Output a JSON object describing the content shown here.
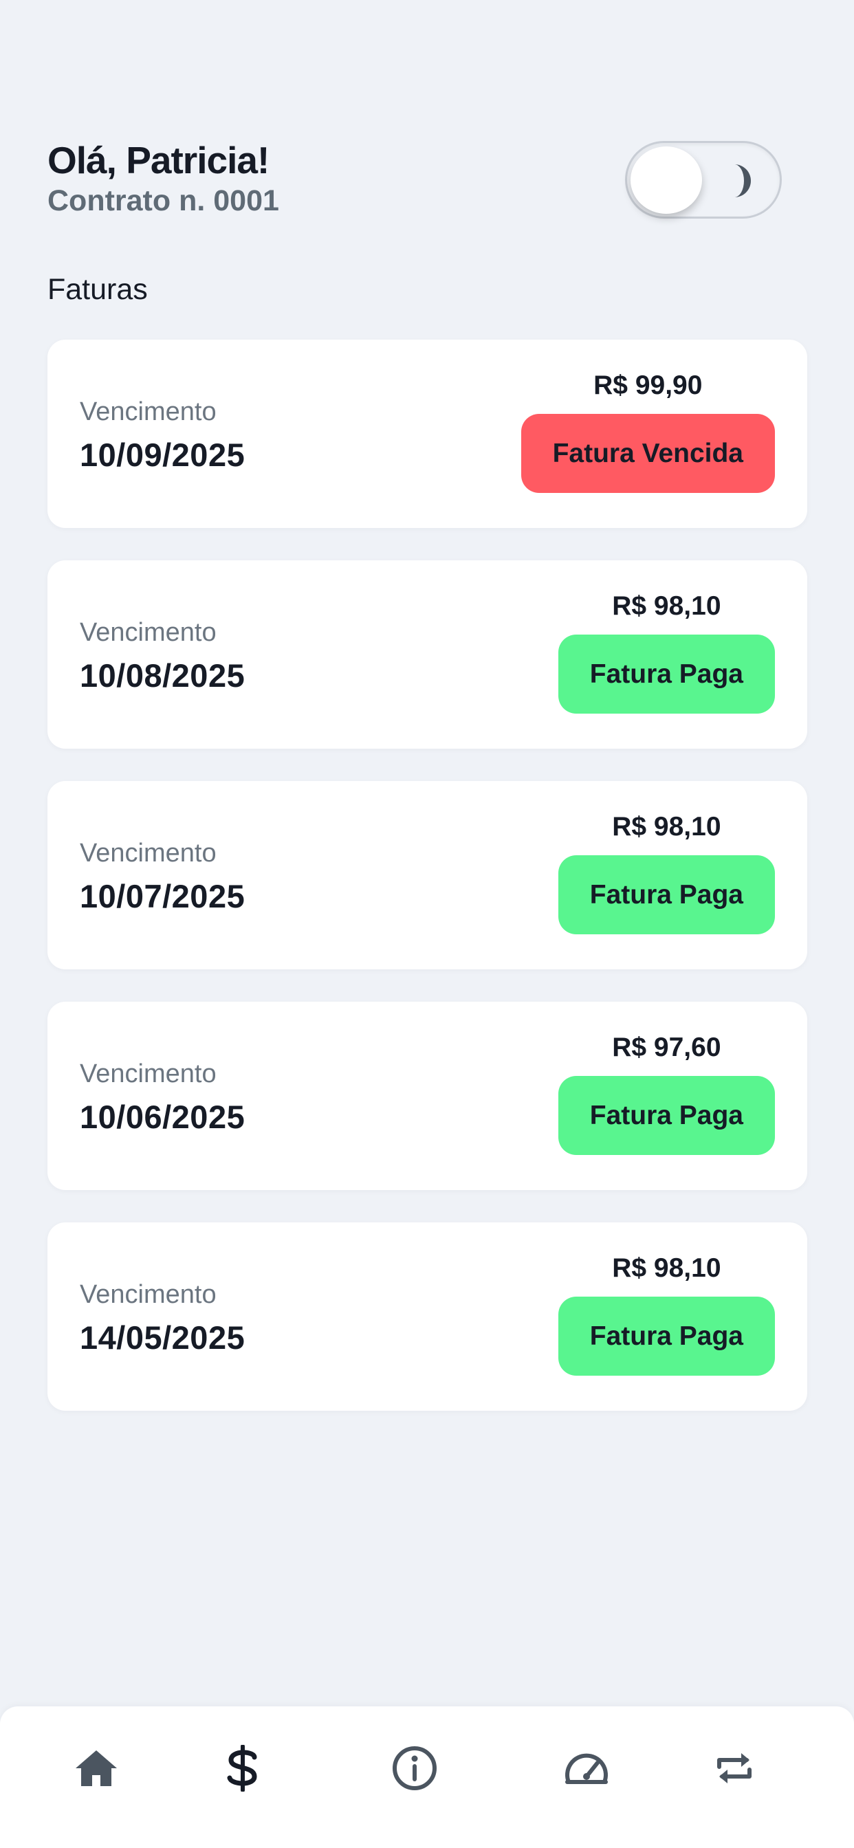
{
  "header": {
    "greeting": "Olá, Patricia!",
    "contract": "Contrato n. 0001"
  },
  "theme_toggle": {
    "icon": "moon-icon",
    "state": "off"
  },
  "section_title": "Faturas",
  "invoices": [
    {
      "due_label": "Vencimento",
      "due_date": "10/09/2025",
      "amount": "R$ 99,90",
      "status": "Fatura Vencida",
      "status_type": "overdue"
    },
    {
      "due_label": "Vencimento",
      "due_date": "10/08/2025",
      "amount": "R$ 98,10",
      "status": "Fatura Paga",
      "status_type": "paid"
    },
    {
      "due_label": "Vencimento",
      "due_date": "10/07/2025",
      "amount": "R$ 98,10",
      "status": "Fatura Paga",
      "status_type": "paid"
    },
    {
      "due_label": "Vencimento",
      "due_date": "10/06/2025",
      "amount": "R$ 97,60",
      "status": "Fatura Paga",
      "status_type": "paid"
    },
    {
      "due_label": "Vencimento",
      "due_date": "14/05/2025",
      "amount": "R$ 98,10",
      "status": "Fatura Paga",
      "status_type": "paid"
    }
  ],
  "nav": {
    "items": [
      "home-icon",
      "dollar-icon",
      "info-icon",
      "speedometer-icon",
      "repeat-icon"
    ],
    "active": "dollar-icon"
  },
  "colors": {
    "background": "#eff2f7",
    "paid": "#59f58f",
    "overdue": "#ff5a62",
    "text_primary": "#161b26",
    "text_secondary": "#6b7580"
  }
}
